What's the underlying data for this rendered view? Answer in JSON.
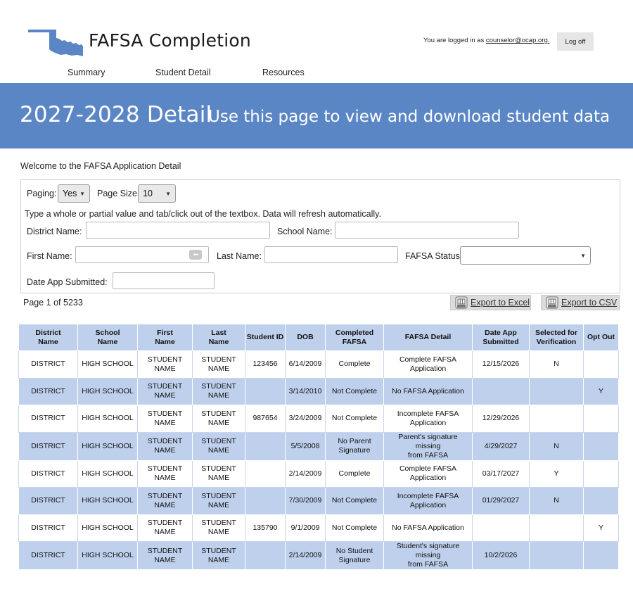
{
  "header": {
    "app_title": "FAFSA Completion",
    "login_prefix": "You are logged in as ",
    "login_email": "counselor@ocap.org.",
    "logoff_label": "Log off"
  },
  "nav": {
    "items": [
      {
        "label": "Summary"
      },
      {
        "label": "Student Detail"
      },
      {
        "label": "Resources"
      }
    ]
  },
  "banner": {
    "title": "2027-2028 Detail",
    "subtitle": "Use this page to view and download student data"
  },
  "welcome": "Welcome to the FAFSA Application Detail",
  "filters": {
    "paging_label": "Paging:",
    "paging_value": "Yes",
    "page_size_label": "Page Size:",
    "page_size_value": "10",
    "hint": "Type a whole or partial value and tab/click out of the textbox. Data will refresh automatically.",
    "district_label": "District Name:",
    "district_value": "",
    "school_label": "School Name:",
    "school_value": "",
    "first_label": "First Name:",
    "first_value": "",
    "last_label": "Last Name:",
    "last_value": "",
    "status_label": "FAFSA Status:",
    "status_value": "",
    "date_label": "Date App Submitted:",
    "date_value": ""
  },
  "page_count": "Page 1 of 5233",
  "export": {
    "excel_label": "Export to Excel",
    "csv_label": "Export to CSV"
  },
  "colors": {
    "banner": "#5b86c6",
    "row_alt": "#bfd0ec"
  },
  "table": {
    "headers": [
      [
        "District",
        "Name"
      ],
      [
        "School",
        "Name"
      ],
      [
        "First",
        "Name"
      ],
      [
        "Last",
        "Name"
      ],
      [
        "Student ID"
      ],
      [
        "DOB"
      ],
      [
        "Completed",
        "FAFSA"
      ],
      [
        "FAFSA Detail"
      ],
      [
        "Date App",
        "Submitted"
      ],
      [
        "Selected for",
        "Verification"
      ],
      [
        "Opt Out"
      ]
    ],
    "rows": [
      [
        "DISTRICT",
        "HIGH SCHOOL",
        "STUDENT\nNAME",
        "STUDENT\nNAME",
        "123456",
        "6/14/2009",
        "Complete",
        "Complete FAFSA\nApplication",
        "12/15/2026",
        "N",
        ""
      ],
      [
        "DISTRICT",
        "HIGH SCHOOL",
        "STUDENT\nNAME",
        "STUDENT\nNAME",
        "",
        "3/14/2010",
        "Not Complete",
        "No FAFSA Application",
        "",
        "",
        "Y"
      ],
      [
        "DISTRICT",
        "HIGH SCHOOL",
        "STUDENT\nNAME",
        "STUDENT\nNAME",
        "987654",
        "3/24/2009",
        "Not Complete",
        "Incomplete FAFSA\nApplication",
        "12/29/2026",
        "",
        ""
      ],
      [
        "DISTRICT",
        "HIGH SCHOOL",
        "STUDENT\nNAME",
        "STUDENT\nNAME",
        "",
        "5/5/2008",
        "No Parent\nSignature",
        "Parent's signature missing\nfrom FAFSA",
        "4/29/2027",
        "N",
        ""
      ],
      [
        "DISTRICT",
        "HIGH SCHOOL",
        "STUDENT\nNAME",
        "STUDENT\nNAME",
        "",
        "2/14/2009",
        "Complete",
        "Complete FAFSA\nApplication",
        "03/17/2027",
        "Y",
        ""
      ],
      [
        "DISTRICT",
        "HIGH SCHOOL",
        "STUDENT\nNAME",
        "STUDENT\nNAME",
        "",
        "7/30/2009",
        "Not Complete",
        "Incomplete FAFSA\nApplication",
        "01/29/2027",
        "N",
        ""
      ],
      [
        "DISTRICT",
        "HIGH SCHOOL",
        "STUDENT\nNAME",
        "STUDENT\nNAME",
        "135790",
        "9/1/2009",
        "Not Complete",
        "No FAFSA Application",
        "",
        "",
        "Y"
      ],
      [
        "DISTRICT",
        "HIGH SCHOOL",
        "STUDENT\nNAME",
        "STUDENT\nNAME",
        "",
        "2/14/2009",
        "No Student\nSignature",
        "Student's signature missing\nfrom FAFSA",
        "10/2/2026",
        "",
        ""
      ]
    ]
  }
}
